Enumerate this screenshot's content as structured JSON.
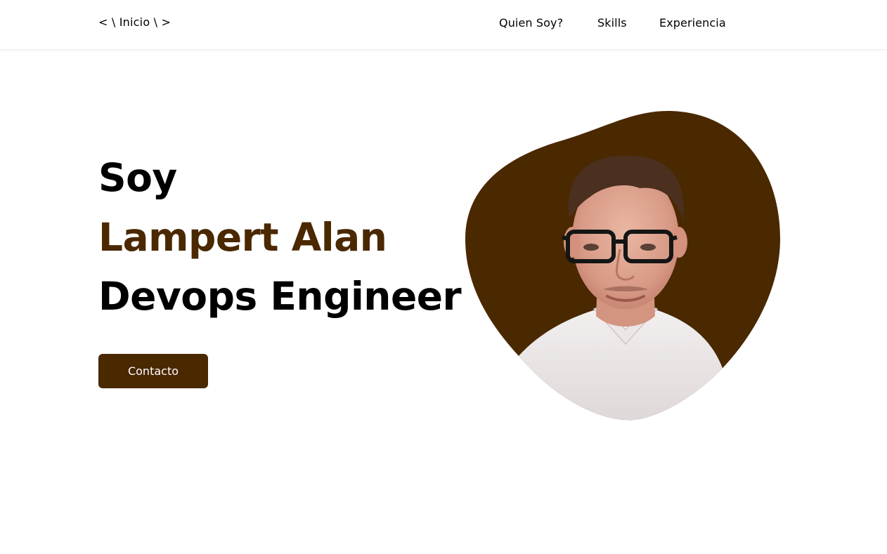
{
  "header": {
    "logo": "< \\ Inicio \\ >",
    "nav": [
      {
        "label": "Quien Soy?"
      },
      {
        "label": "Skills"
      },
      {
        "label": "Experiencia"
      }
    ]
  },
  "hero": {
    "line1": "Soy",
    "line2": "Lampert Alan",
    "line3": "Devops Engineer",
    "cta_label": "Contacto"
  },
  "colors": {
    "accent": "#4a2800",
    "background": "#ffffff",
    "text": "#000000"
  }
}
